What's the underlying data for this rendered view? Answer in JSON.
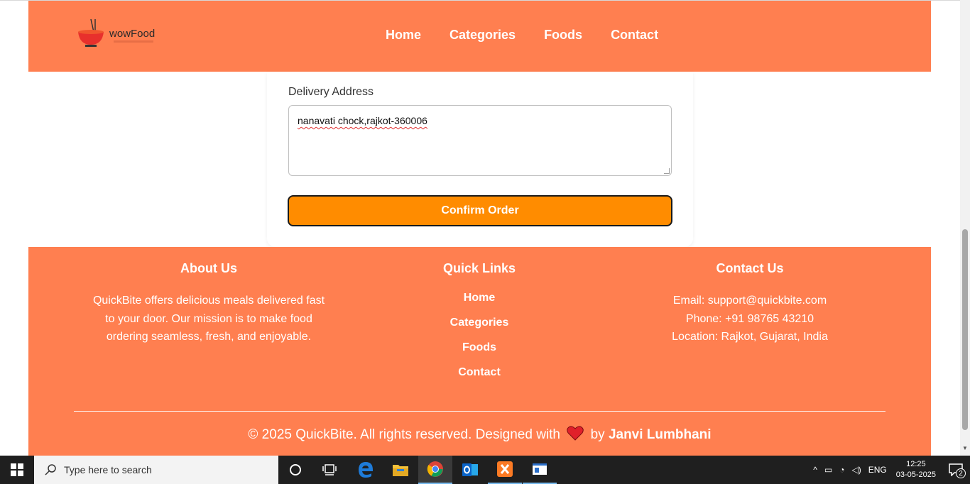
{
  "header": {
    "logo_text": "wowFood",
    "nav": [
      "Home",
      "Categories",
      "Foods",
      "Contact"
    ]
  },
  "form": {
    "address_label": "Delivery Address",
    "address_value": "nanavati chock,rajkot-360006",
    "confirm_label": "Confirm Order"
  },
  "footer": {
    "about": {
      "title": "About Us",
      "lines": [
        "QuickBite offers delicious meals delivered fast",
        "to your door. Our mission is to make food",
        "ordering seamless, fresh, and enjoyable."
      ]
    },
    "quick_links": {
      "title": "Quick Links",
      "items": [
        "Home",
        "Categories",
        "Foods",
        "Contact"
      ]
    },
    "contact": {
      "title": "Contact Us",
      "email": "Email: support@quickbite.com",
      "phone": "Phone: +91 98765 43210",
      "location": "Location: Rajkot, Gujarat, India"
    },
    "copyright_prefix": "© 2025 QuickBite. All rights reserved. Designed with",
    "copyright_by": "by",
    "designer": "Janvi Lumbhani"
  },
  "taskbar": {
    "search_placeholder": "Type here to search",
    "language": "ENG",
    "time": "12:25",
    "date": "03-05-2025",
    "notification_count": "2"
  },
  "colors": {
    "brand": "#ff7f50",
    "button": "#ff8c00"
  }
}
